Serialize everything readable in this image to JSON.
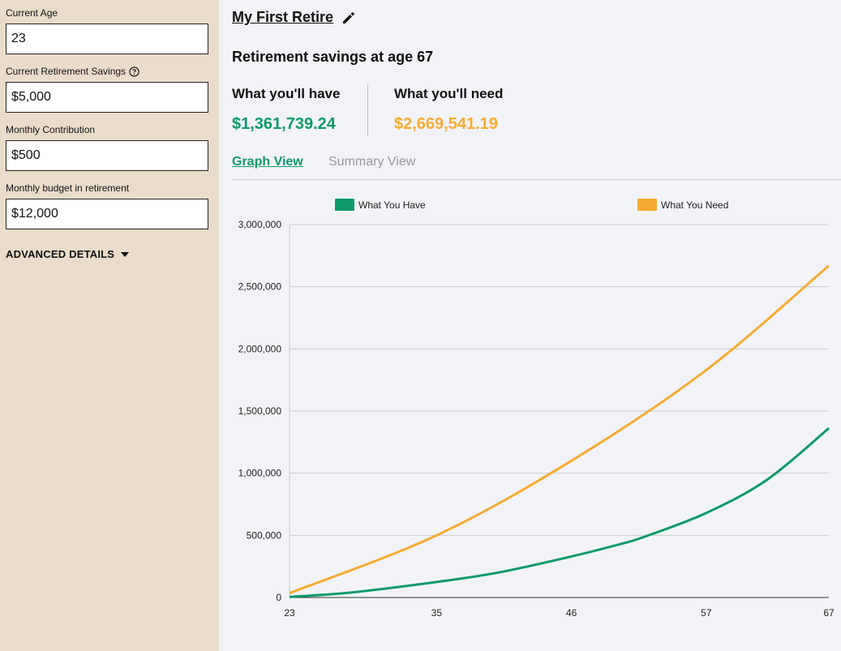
{
  "sidebar": {
    "fields": [
      {
        "label": "Current Age",
        "value": "23",
        "help": false
      },
      {
        "label": "Current Retirement Savings",
        "value": "$5,000",
        "help": true
      },
      {
        "label": "Monthly Contribution",
        "value": "$500",
        "help": false
      },
      {
        "label": "Monthly budget in retirement",
        "value": "$12,000",
        "help": false
      }
    ],
    "advanced_label": "ADVANCED DETAILS"
  },
  "plan": {
    "title": "My First Retire"
  },
  "summary": {
    "heading": "Retirement savings at age 67",
    "have_label": "What you'll have",
    "have_value": "$1,361,739.24",
    "need_label": "What you'll need",
    "need_value": "$2,669,541.19"
  },
  "tabs": [
    {
      "label": "Graph View",
      "active": true
    },
    {
      "label": "Summary View",
      "active": false
    }
  ],
  "colors": {
    "have": "#0e9a6a",
    "need": "#f7aa31",
    "sidebar": "#e9ddc9"
  },
  "chart_data": {
    "type": "line",
    "xlim": [
      23,
      67
    ],
    "ylim": [
      0,
      3000000
    ],
    "x_ticks": [
      23,
      35,
      46,
      57,
      67
    ],
    "y_ticks": [
      "0",
      "500,000",
      "1,000,000",
      "1,500,000",
      "2,000,000",
      "2,500,000",
      "3,000,000"
    ],
    "grid": true,
    "legend_position": "top",
    "series": [
      {
        "name": "What You Have",
        "color": "#0e9a6a",
        "points": [
          [
            23,
            5000
          ],
          [
            28,
            40000
          ],
          [
            35,
            125000
          ],
          [
            40,
            200000
          ],
          [
            46,
            330000
          ],
          [
            50,
            430000
          ],
          [
            52,
            490000
          ],
          [
            57,
            680000
          ],
          [
            62,
            950000
          ],
          [
            67,
            1361739
          ]
        ]
      },
      {
        "name": "What You Need",
        "color": "#f7aa31",
        "points": [
          [
            23,
            35000
          ],
          [
            35,
            500000
          ],
          [
            46,
            1100000
          ],
          [
            57,
            1830000
          ],
          [
            67,
            2669541
          ]
        ]
      }
    ]
  }
}
